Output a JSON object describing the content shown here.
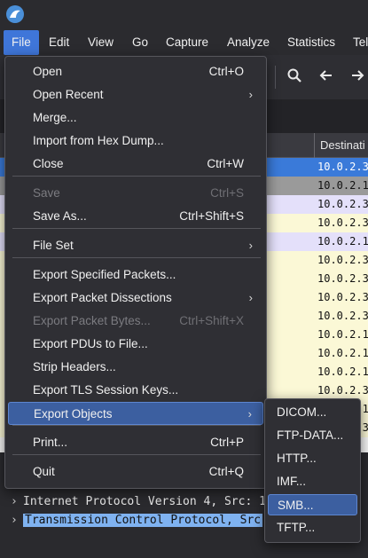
{
  "menubar": {
    "items": [
      "File",
      "Edit",
      "View",
      "Go",
      "Capture",
      "Analyze",
      "Statistics",
      "Tel"
    ]
  },
  "packet_list": {
    "column_header": "Destinati",
    "rows": [
      {
        "dest": "10.0.2.3",
        "bg": "#3a7ad9",
        "fg": "#ffffff"
      },
      {
        "dest": "10.0.2.1",
        "bg": "#9a9a9a",
        "fg": "#111111"
      },
      {
        "dest": "10.0.2.3",
        "bg": "#e4e0fa",
        "fg": "#111111"
      },
      {
        "dest": "10.0.2.3",
        "bg": "#fbf8d6",
        "fg": "#111111"
      },
      {
        "dest": "10.0.2.1",
        "bg": "#e4e0fa",
        "fg": "#111111"
      },
      {
        "dest": "10.0.2.3",
        "bg": "#fbf8d6",
        "fg": "#111111"
      },
      {
        "dest": "10.0.2.3",
        "bg": "#fbf8d6",
        "fg": "#111111"
      },
      {
        "dest": "10.0.2.3",
        "bg": "#fbf8d6",
        "fg": "#111111"
      },
      {
        "dest": "10.0.2.3",
        "bg": "#fbf8d6",
        "fg": "#111111"
      },
      {
        "dest": "10.0.2.1",
        "bg": "#fbf8d6",
        "fg": "#111111"
      },
      {
        "dest": "10.0.2.1",
        "bg": "#fbf8d6",
        "fg": "#111111"
      },
      {
        "dest": "10.0.2.1",
        "bg": "#fbf8d6",
        "fg": "#111111"
      },
      {
        "dest": "10.0.2.3",
        "bg": "#fbf8d6",
        "fg": "#111111"
      },
      {
        "dest": "10.0.2.1",
        "bg": "#fbf8d6",
        "fg": "#111111"
      },
      {
        "dest": "10.0.2.3",
        "bg": "#fbf8d6",
        "fg": "#111111"
      }
    ]
  },
  "details": {
    "rows": [
      {
        "text": "Internet Protocol Version 4, Src: 1",
        "selected": false
      },
      {
        "text": "Transmission Control Protocol, Src",
        "selected": true
      }
    ]
  },
  "file_menu": {
    "items": [
      {
        "label": "Open",
        "shortcut": "Ctrl+O",
        "submenu": false,
        "disabled": false
      },
      {
        "label": "Open Recent",
        "shortcut": "",
        "submenu": true,
        "disabled": false
      },
      {
        "label": "Merge...",
        "shortcut": "",
        "submenu": false,
        "disabled": false
      },
      {
        "label": "Import from Hex Dump...",
        "shortcut": "",
        "submenu": false,
        "disabled": false
      },
      {
        "label": "Close",
        "shortcut": "Ctrl+W",
        "submenu": false,
        "disabled": false
      },
      {
        "label": "Save",
        "shortcut": "Ctrl+S",
        "submenu": false,
        "disabled": true
      },
      {
        "label": "Save As...",
        "shortcut": "Ctrl+Shift+S",
        "submenu": false,
        "disabled": false
      },
      {
        "label": "File Set",
        "shortcut": "",
        "submenu": true,
        "disabled": false
      },
      {
        "label": "Export Specified Packets...",
        "shortcut": "",
        "submenu": false,
        "disabled": false
      },
      {
        "label": "Export Packet Dissections",
        "shortcut": "",
        "submenu": true,
        "disabled": false
      },
      {
        "label": "Export Packet Bytes...",
        "shortcut": "Ctrl+Shift+X",
        "submenu": false,
        "disabled": true
      },
      {
        "label": "Export PDUs to File...",
        "shortcut": "",
        "submenu": false,
        "disabled": false
      },
      {
        "label": "Strip Headers...",
        "shortcut": "",
        "submenu": false,
        "disabled": false
      },
      {
        "label": "Export TLS Session Keys...",
        "shortcut": "",
        "submenu": false,
        "disabled": false
      },
      {
        "label": "Export Objects",
        "shortcut": "",
        "submenu": true,
        "disabled": false
      },
      {
        "label": "Print...",
        "shortcut": "Ctrl+P",
        "submenu": false,
        "disabled": false
      },
      {
        "label": "Quit",
        "shortcut": "Ctrl+Q",
        "submenu": false,
        "disabled": false
      }
    ]
  },
  "export_objects_menu": {
    "items": [
      "DICOM...",
      "FTP-DATA...",
      "HTTP...",
      "IMF...",
      "SMB...",
      "TFTP..."
    ]
  },
  "colors": {
    "accent": "#3f76d9",
    "highlight": "#3c5fa0",
    "menu_bg": "#2f2f34"
  }
}
